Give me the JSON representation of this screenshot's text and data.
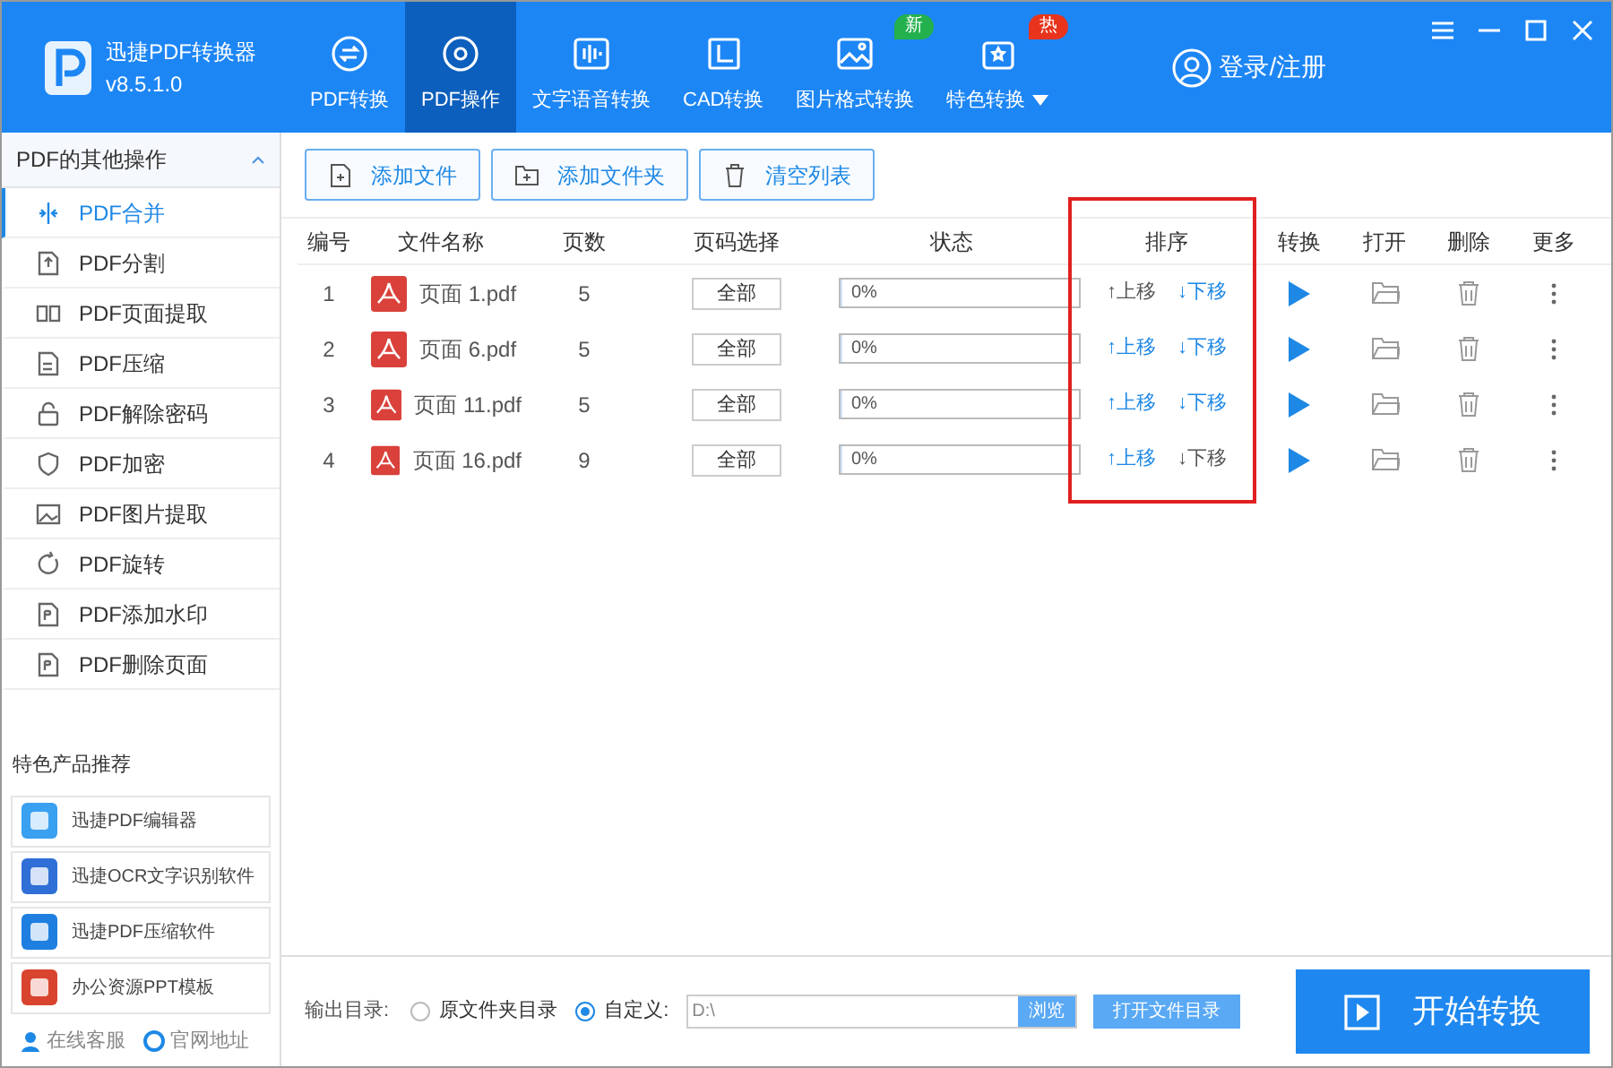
{
  "app": {
    "name": "迅捷PDF转换器",
    "version": "v8.5.1.0"
  },
  "nav": [
    {
      "label": "PDF转换",
      "selected": false
    },
    {
      "label": "PDF操作",
      "selected": true
    },
    {
      "label": "文字语音转换",
      "selected": false
    },
    {
      "label": "CAD转换",
      "selected": false
    },
    {
      "label": "图片格式转换",
      "selected": false,
      "badge": "新",
      "color": "#22b14c"
    },
    {
      "label": "特色转换",
      "selected": false,
      "badge": "热",
      "color": "#e8341c",
      "dropdown": true
    }
  ],
  "login": "登录/注册",
  "sidebar": {
    "title": "PDF的其他操作",
    "items": [
      {
        "label": "PDF合并",
        "selected": true
      },
      {
        "label": "PDF分割",
        "selected": false
      },
      {
        "label": "PDF页面提取",
        "selected": false
      },
      {
        "label": "PDF压缩",
        "selected": false
      },
      {
        "label": "PDF解除密码",
        "selected": false
      },
      {
        "label": "PDF加密",
        "selected": false
      },
      {
        "label": "PDF图片提取",
        "selected": false
      },
      {
        "label": "PDF旋转",
        "selected": false
      },
      {
        "label": "PDF添加水印",
        "selected": false
      },
      {
        "label": "PDF删除页面",
        "selected": false
      }
    ],
    "products_title": "特色产品推荐",
    "products": [
      {
        "label": "迅捷PDF编辑器"
      },
      {
        "label": "迅捷OCR文字识别软件"
      },
      {
        "label": "迅捷PDF压缩软件"
      },
      {
        "label": "办公资源PPT模板"
      }
    ],
    "links": [
      "在线客服",
      "官网地址"
    ]
  },
  "toolbar": [
    "添加文件",
    "添加文件夹",
    "清空列表"
  ],
  "table": {
    "columns": [
      "编号",
      "文件名称",
      "页数",
      "页码选择",
      "状态",
      "排序",
      "转换",
      "打开",
      "删除",
      "更多"
    ],
    "rows": [
      {
        "index": "1",
        "name": "页面 1.pdf",
        "pages": "5",
        "range": "全部",
        "progress": "0%",
        "level": 0,
        "up": "↑上移",
        "down": "↓下移",
        "up_disabled": true,
        "down_disabled": false
      },
      {
        "index": "2",
        "name": "页面 6.pdf",
        "pages": "5",
        "range": "全部",
        "progress": "0%",
        "level": 0,
        "up": "↑上移",
        "down": "↓下移",
        "up_disabled": false,
        "down_disabled": false
      },
      {
        "index": "3",
        "name": "页面 11.pdf",
        "pages": "5",
        "range": "全部",
        "progress": "0%",
        "level": 0,
        "up": "↑上移",
        "down": "↓下移",
        "up_disabled": false,
        "down_disabled": false
      },
      {
        "index": "4",
        "name": "页面 16.pdf",
        "pages": "9",
        "range": "全部",
        "progress": "0%",
        "level": 0,
        "up": "↑上移",
        "down": "↓下移",
        "up_disabled": false,
        "down_disabled": true
      }
    ]
  },
  "output": {
    "label": "输出目录:",
    "options": [
      {
        "label": "原文件夹目录",
        "selected": false
      },
      {
        "label": "自定义:",
        "selected": true
      }
    ],
    "path": "D:\\",
    "browse": "浏览",
    "open_dir": "打开文件目录"
  },
  "start": "开始转换"
}
